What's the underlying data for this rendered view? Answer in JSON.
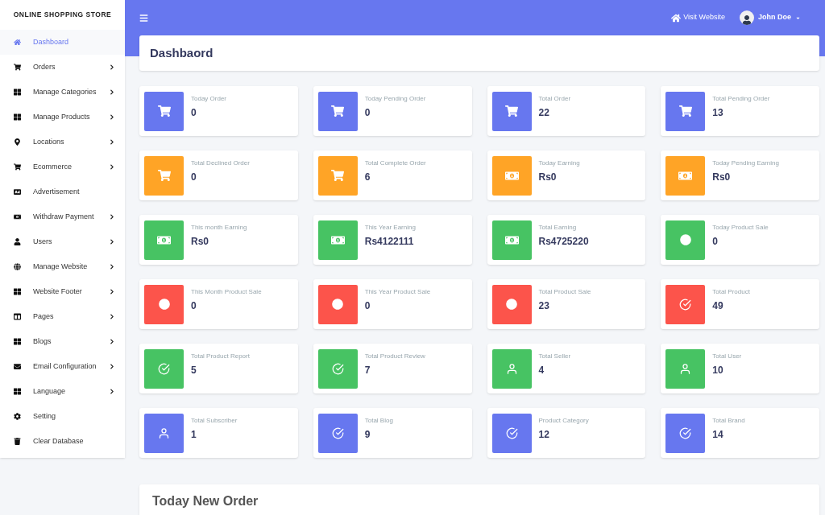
{
  "brand": "ONLINE SHOPPING STORE",
  "sidebar": {
    "items": [
      {
        "label": "Dashboard",
        "kind": "home",
        "submenu": false,
        "selected": true
      },
      {
        "label": "Orders",
        "kind": "cart",
        "submenu": true,
        "selected": false
      },
      {
        "label": "Manage Categories",
        "kind": "grid",
        "submenu": true,
        "selected": false
      },
      {
        "label": "Manage Products",
        "kind": "grid",
        "submenu": true,
        "selected": false
      },
      {
        "label": "Locations",
        "kind": "pin",
        "submenu": true,
        "selected": false
      },
      {
        "label": "Ecommerce",
        "kind": "cart",
        "submenu": true,
        "selected": false
      },
      {
        "label": "Advertisement",
        "kind": "ad",
        "submenu": false,
        "selected": false
      },
      {
        "label": "Withdraw Payment",
        "kind": "money",
        "submenu": true,
        "selected": false
      },
      {
        "label": "Users",
        "kind": "user",
        "submenu": true,
        "selected": false
      },
      {
        "label": "Manage Website",
        "kind": "globe",
        "submenu": true,
        "selected": false
      },
      {
        "label": "Website Footer",
        "kind": "grid",
        "submenu": true,
        "selected": false
      },
      {
        "label": "Pages",
        "kind": "columns",
        "submenu": true,
        "selected": false
      },
      {
        "label": "Blogs",
        "kind": "grid",
        "submenu": true,
        "selected": false
      },
      {
        "label": "Email Configuration",
        "kind": "envelope",
        "submenu": true,
        "selected": false
      },
      {
        "label": "Language",
        "kind": "grid",
        "submenu": true,
        "selected": false
      },
      {
        "label": "Setting",
        "kind": "cog",
        "submenu": false,
        "selected": false
      },
      {
        "label": "Clear Database",
        "kind": "trash",
        "submenu": false,
        "selected": false
      }
    ]
  },
  "topbar": {
    "visit_website": "Visit Website",
    "user_name": "John Doe"
  },
  "page_title": "Dashbaord",
  "stats": [
    {
      "label": "Today Order",
      "value": "0",
      "kind": "cart",
      "color": "#6777ef"
    },
    {
      "label": "Today Pending Order",
      "value": "0",
      "kind": "cart",
      "color": "#6777ef"
    },
    {
      "label": "Total Order",
      "value": "22",
      "kind": "cart",
      "color": "#6777ef"
    },
    {
      "label": "Total Pending Order",
      "value": "13",
      "kind": "cart",
      "color": "#6777ef"
    },
    {
      "label": "Total Declined Order",
      "value": "0",
      "kind": "cart",
      "color": "#ffa426"
    },
    {
      "label": "Total Complete Order",
      "value": "6",
      "kind": "cart",
      "color": "#ffa426"
    },
    {
      "label": "Today Earning",
      "value": "Rs0",
      "kind": "money",
      "color": "#ffa426"
    },
    {
      "label": "Today Pending Earning",
      "value": "Rs0",
      "kind": "money",
      "color": "#ffa426"
    },
    {
      "label": "This month Earning",
      "value": "Rs0",
      "kind": "money",
      "color": "#47c363"
    },
    {
      "label": "This Year Earning",
      "value": "Rs4122111",
      "kind": "money",
      "color": "#47c363"
    },
    {
      "label": "Total Earning",
      "value": "Rs4725220",
      "kind": "money",
      "color": "#47c363"
    },
    {
      "label": "Today Product Sale",
      "value": "0",
      "kind": "circle",
      "color": "#47c363"
    },
    {
      "label": "This Month Product Sale",
      "value": "0",
      "kind": "circle",
      "color": "#fc544b"
    },
    {
      "label": "This Year Product Sale",
      "value": "0",
      "kind": "circle",
      "color": "#fc544b"
    },
    {
      "label": "Total Product Sale",
      "value": "23",
      "kind": "circle",
      "color": "#fc544b"
    },
    {
      "label": "Total Product",
      "value": "49",
      "kind": "check",
      "color": "#fc544b"
    },
    {
      "label": "Total Product Report",
      "value": "5",
      "kind": "check",
      "color": "#47c363"
    },
    {
      "label": "Total Product Review",
      "value": "7",
      "kind": "check",
      "color": "#47c363"
    },
    {
      "label": "Total Seller",
      "value": "4",
      "kind": "user",
      "color": "#47c363"
    },
    {
      "label": "Total User",
      "value": "10",
      "kind": "user",
      "color": "#47c363"
    },
    {
      "label": "Total Subscriber",
      "value": "1",
      "kind": "user",
      "color": "#6777ef"
    },
    {
      "label": "Total Blog",
      "value": "9",
      "kind": "check",
      "color": "#6777ef"
    },
    {
      "label": "Product Category",
      "value": "12",
      "kind": "check",
      "color": "#6777ef"
    },
    {
      "label": "Total Brand",
      "value": "14",
      "kind": "check",
      "color": "#6777ef"
    }
  ],
  "section_title": "Today New Order"
}
